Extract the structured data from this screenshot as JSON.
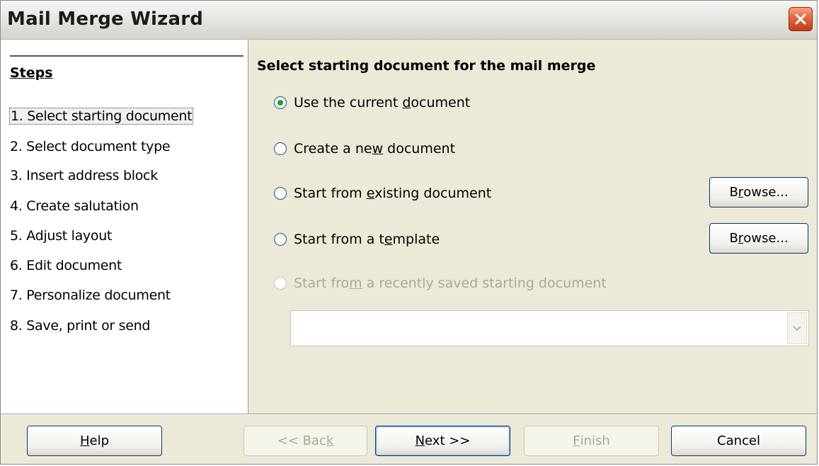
{
  "window": {
    "title": "Mail Merge Wizard"
  },
  "steps": {
    "title": "Steps",
    "items": [
      "1. Select starting document",
      "2. Select document type",
      "3. Insert address block",
      "4. Create salutation",
      "5. Adjust layout",
      "6. Edit document",
      "7. Personalize document",
      "8. Save, print or send"
    ],
    "active_index": 0
  },
  "main": {
    "heading": "Select starting document for the mail merge",
    "options": [
      {
        "pre": "Use the current ",
        "mn": "d",
        "post": "ocument",
        "checked": true,
        "enabled": true
      },
      {
        "pre": "Create a ne",
        "mn": "w",
        "post": " document",
        "checked": false,
        "enabled": true
      },
      {
        "pre": "Start from ",
        "mn": "e",
        "post": "xisting document",
        "checked": false,
        "enabled": true
      },
      {
        "pre": "Start from a t",
        "mn": "e",
        "post": "mplate",
        "checked": false,
        "enabled": true
      },
      {
        "pre": "Start fro",
        "mn": "m",
        "post": " a recently saved starting document",
        "checked": false,
        "enabled": false
      }
    ],
    "browse1": {
      "pre": "B",
      "mn": "r",
      "post": "owse..."
    },
    "browse2": {
      "pre": "B",
      "mn": "r",
      "post": "owse..."
    },
    "recent_combo": {
      "value": ""
    }
  },
  "footer": {
    "help": {
      "pre": "",
      "mn": "H",
      "post": "elp"
    },
    "back": {
      "pre": "<< Bac",
      "mn": "k",
      "post": ""
    },
    "next": {
      "pre": "",
      "mn": "N",
      "post": "ext >>"
    },
    "finish": {
      "pre": "",
      "mn": "F",
      "post": "inish"
    },
    "cancel": {
      "pre": "Cancel",
      "mn": "",
      "post": ""
    }
  }
}
